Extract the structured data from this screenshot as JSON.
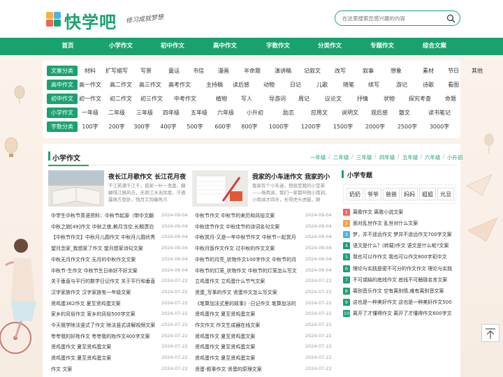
{
  "logo": {
    "title": "快学吧",
    "slogan": "修习成就梦想"
  },
  "search": {
    "placeholder": "在这里搜索您感兴趣的内容"
  },
  "nav": [
    "首页",
    "小学作文",
    "初中作文",
    "高中作文",
    "字数作文",
    "分类作文",
    "专题作文",
    "综合文案"
  ],
  "categories": [
    {
      "label": "文案分类",
      "items": [
        "材料",
        "扩写缩写",
        "写景",
        "童话",
        "书信",
        "漫画",
        "半命题",
        "演讲稿",
        "记叙文",
        "改写",
        "叙事",
        "想象",
        "素材",
        "节日",
        "其他"
      ]
    },
    {
      "label": "高中作文",
      "items": [
        "高一作文",
        "高二作文",
        "高三作文",
        "高考作文",
        "主持稿",
        "读后感",
        "动物",
        "日记",
        "儿歌",
        "随笔",
        "续写",
        "游记",
        "诗歌",
        "看图"
      ]
    },
    {
      "label": "初中作文",
      "items": [
        "初一作文",
        "初二作文",
        "初三作文",
        "中考作文",
        "植物",
        "写人",
        "导游词",
        "周记",
        "议论文",
        "抒情",
        "状物",
        "探究考查",
        "命题"
      ]
    },
    {
      "label": "小学作文",
      "items": [
        "一年级",
        "二年级",
        "三年级",
        "四年级",
        "五年级",
        "六年级",
        "小升初",
        "励志",
        "应用文",
        "说明文",
        "观后感",
        "散文",
        "读书笔记"
      ]
    },
    {
      "label": "字数分类",
      "items": [
        "100字",
        "200字",
        "300字",
        "400字",
        "500字",
        "600字",
        "800字",
        "1000字",
        "1200字",
        "1500字",
        "2000字",
        "2500字",
        "3000字"
      ]
    }
  ],
  "section": {
    "title": "小学作文",
    "tabs": [
      "一年级",
      "二年级",
      "三年级",
      "四年级",
      "五年级",
      "六年级",
      "小升初"
    ],
    "featured": [
      {
        "title": "夜长江月歌作文 长江花月夜",
        "desc": "千江若潮千江千，孤家一叶一渔盏，翩翩惜江随风去，无垠江水无际度。汗透露珠方登卧，残月又钩痛焦爪"
      },
      {
        "title": "我家的小车迷作文 我家的小",
        "desc": "我家有个小车迷，他就是我的小堂弟——杨雨涧，我们一家都叫他小雨涧，小雨涧才四岁，长得虎头虎脑，眼"
      }
    ],
    "list_left": [
      {
        "t": "中学生中秋节英语资料：中秋节起源（带中文翻",
        "d": "2024-09-04"
      },
      {
        "t": "中秋之旅[49]作文 中秋之夜,赖月当空,长期漂泊",
        "d": "2024-09-04"
      },
      {
        "t": "【中秋节作文】中秋月儿圆作文 中秋月儿圆优秀",
        "d": "2024-09-04"
      },
      {
        "t": "望月念家_我想家了作文 望月想家诗句文案",
        "d": "2024-09-04"
      },
      {
        "t": "中秋无月作文作文 无月的中秋作文文案",
        "d": "2024-09-04"
      },
      {
        "t": "中秋节-生作文 中秋节生日命好不好文案",
        "d": "2024-09-04"
      },
      {
        "t": "关于垂直与平行的数学日记作文 关于平行和垂直",
        "d": "2024-07-22"
      },
      {
        "t": "汉字家族作文 汉字家族有一年级文案",
        "d": "2024-07-22"
      },
      {
        "t": "贤鸡蛋362作文 夏至贤鸡蛋文案",
        "d": "2024-07-22"
      },
      {
        "t": "家乡的风俗作文 家乡的风俗500字文案",
        "d": "2024-07-22"
      },
      {
        "t": "今天我学除法竖式了作文 除法竖式讲解视频文案",
        "d": "2024-07-22"
      },
      {
        "t": "夸夸我的好姓作文 夸夸我的姓作文400字文案",
        "d": "2024-07-22"
      },
      {
        "t": "贤鸡蛋作文 夏至贤鸡蛋文案",
        "d": "2024-07-22"
      },
      {
        "t": "贤鸡蛋作文 夏至贤鸡蛋文案",
        "d": "2024-07-22"
      },
      {
        "t": "作文 文案",
        "d": "2024-07-22"
      }
    ],
    "list_right": [
      {
        "t": "中秋节作文 中秋节的来历和风俗文案",
        "d": "2024-09-04"
      },
      {
        "t": "中秋佳节作文 中秋佳节的诗词名句文案",
        "d": "2024-09-04"
      },
      {
        "t": "中秋赏月-又是一年中秋节作文 中秋节一起赏月",
        "d": "2024-09-04"
      },
      {
        "t": "中秋月饭作文作文 过中秋的作文文案",
        "d": "2024-09-04"
      },
      {
        "t": "中秋节的月亮_状物作文100字作文 中秋节的月",
        "d": "2024-09-04"
      },
      {
        "t": "中秋节的灯笼_状物作文 中秋节的灯笼怎么写文",
        "d": "2024-09-04"
      },
      {
        "t": "立鸡蛋作文 立鸡蛋什么节气文案",
        "d": "2024-07-22"
      },
      {
        "t": "贤蛋_写事的作文 贤蛋作文怎么写文案",
        "d": "2024-07-22"
      },
      {
        "t": "《笔算加法式里的故事》-日记作文 笔算加法的",
        "d": "2024-07-22"
      },
      {
        "t": "贤鸡蛋作文 夏至贤鸡蛋文案",
        "d": "2024-07-22"
      },
      {
        "t": "作文作文 作文生成器在线文案",
        "d": "2024-07-22"
      },
      {
        "t": "贤鸡蛋作文 夏至贤鸡蛋文案",
        "d": "2024-07-22"
      },
      {
        "t": "贤鸡蛋作文 夏至贤鸡蛋文案",
        "d": "2024-07-22"
      },
      {
        "t": "贤鸡蛋作文 夏至贤鸡蛋文案",
        "d": "2024-07-22"
      },
      {
        "t": "贤蛋-叙事作文 贤蛋的原理文案",
        "d": "2024-07-22"
      }
    ]
  },
  "sidebar": {
    "title": "小学专题",
    "tags": [
      "奶奶",
      "爷爷",
      "爸爸",
      "妈妈",
      "姐姐",
      "元旦"
    ],
    "rank": [
      "离歌作文 离歌小说文案",
      "面对乱世作文 乱世对什么文案",
      "梦，并不遥远作文 梦并不遥远作文700字文案",
      "语文是什么？(转载)作文 语文是什么呢?文案",
      "我也可以作作文 我也可以作文800字初中文",
      "理论与实践是密不可分的作文作文 理论与实践",
      "不可或缺的底线作文 底线不可触碰名言文案",
      "离别音乐作文 空有离别情,难有离别音文案",
      "这也是一种美好作文 这也是一种美好作文500",
      "离开了才懂得作文 离开了才懂得作文600字文"
    ]
  },
  "colors": {
    "accent": "#1aa26e",
    "rank": [
      "#f0655a",
      "#f3a244",
      "#4cb2e6",
      "#1aa26e"
    ]
  }
}
